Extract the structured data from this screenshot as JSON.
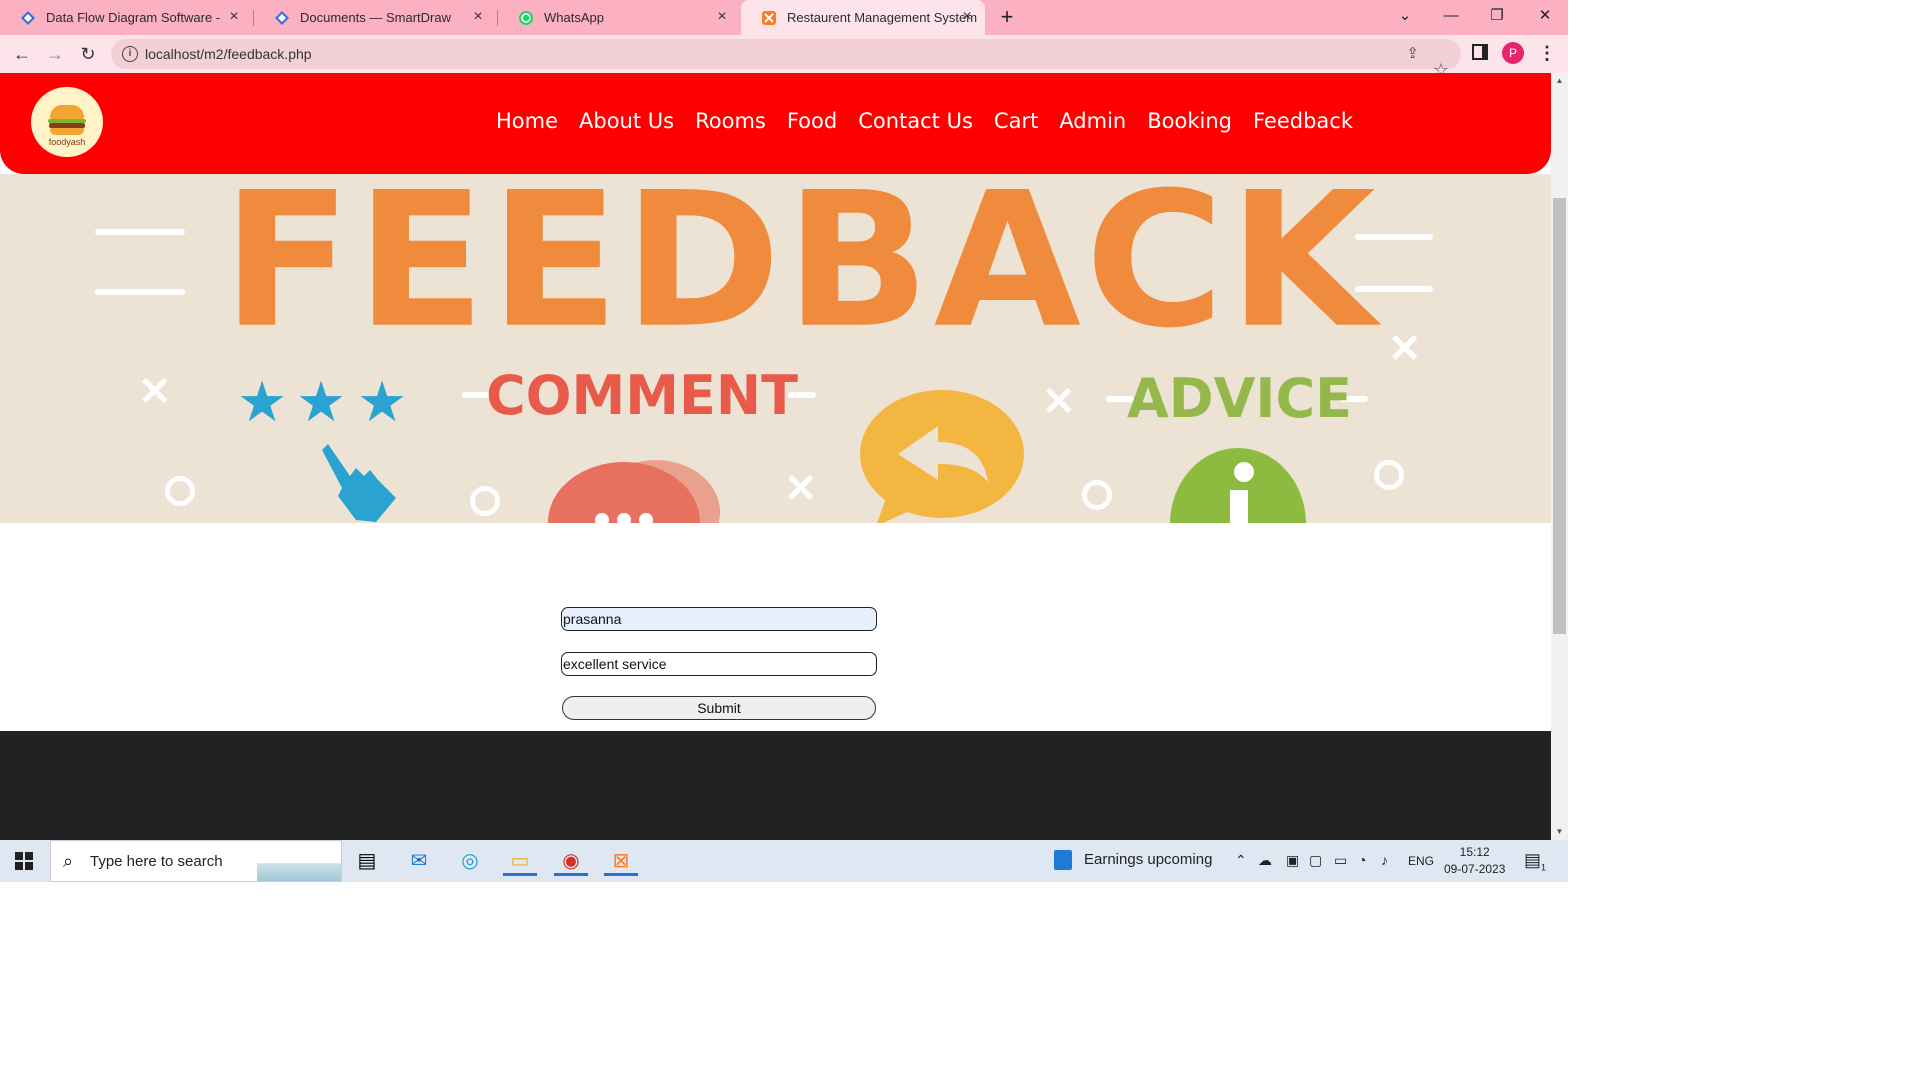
{
  "browser": {
    "tabs": [
      {
        "title": "Data Flow Diagram Software - Fr",
        "icon": "smartdraw-icon"
      },
      {
        "title": "Documents — SmartDraw",
        "icon": "smartdraw-icon"
      },
      {
        "title": "WhatsApp",
        "icon": "whatsapp-icon"
      },
      {
        "title": "Restaurent Management System",
        "icon": "xampp-icon"
      }
    ],
    "new_tab": "+",
    "url": "localhost/m2/feedback.php",
    "profile_initial": "P"
  },
  "site": {
    "logo_text": "foodyash",
    "nav": [
      "Home",
      "About Us",
      "Rooms",
      "Food",
      "Contact Us",
      "Cart",
      "Admin",
      "Booking",
      "Feedback"
    ],
    "banner": {
      "headline": "FEEDBACK",
      "left_word": "COMMENT",
      "right_word": "ADVICE"
    },
    "form": {
      "name_value": "prasanna",
      "message_value": "excellent service",
      "submit_label": "Submit"
    }
  },
  "taskbar": {
    "search_placeholder": "Type here to search",
    "widget_text": "Earnings upcoming",
    "language": "ENG",
    "time": "15:12",
    "date": "09-07-2023",
    "notification_count": "1"
  },
  "colors": {
    "nav_bg": "#ff0000",
    "tabstrip_bg": "#fbb1c2",
    "footer_bg": "#222222",
    "headline": "#f08a3c",
    "comment": "#e85b4a",
    "advice": "#94b84b"
  }
}
